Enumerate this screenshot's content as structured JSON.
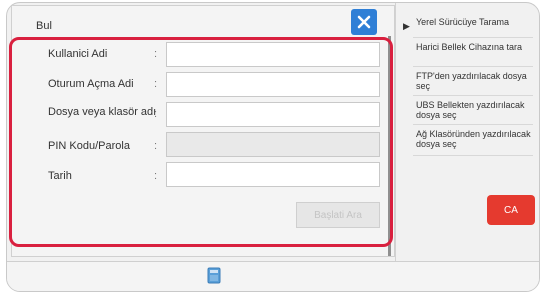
{
  "dialog": {
    "title": "Bul",
    "fields": [
      {
        "label": "Kullanici Adi",
        "value": "",
        "disabled": false
      },
      {
        "label": "Oturum Açma Adi",
        "value": "",
        "disabled": false
      },
      {
        "label": "Dosya veya klasör adı",
        "value": "",
        "disabled": false
      },
      {
        "label": "PIN Kodu/Parola",
        "value": "",
        "disabled": true
      },
      {
        "label": "Tarih",
        "value": "",
        "disabled": false
      }
    ],
    "colon": ":",
    "search_button": "Başlati Ara"
  },
  "side_menu": {
    "items": [
      "Yerel Sürücüye Tarama",
      "Harici Bellek Cihazına tara",
      "FTP'den yazdırılacak dosya seç",
      "UBS Bellekten yazdırılacak dosya seç",
      "Ağ Klasöründen yazdırılacak dosya seç"
    ]
  },
  "ca_button": "CA",
  "colors": {
    "accent_blue": "#2f7fd6",
    "highlight_red": "#d9203f",
    "ca_red": "#e53a2f"
  },
  "icons": {
    "close": "close-icon",
    "arrow": "play-arrow-icon",
    "storage": "storage-icon"
  }
}
